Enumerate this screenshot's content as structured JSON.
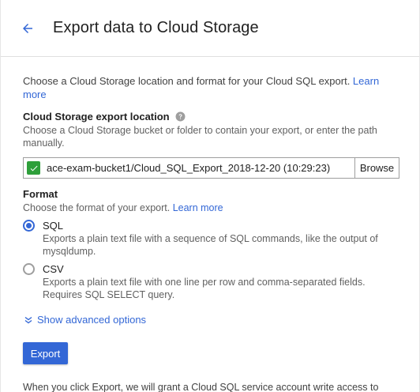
{
  "header": {
    "back_icon": "arrow-left-icon",
    "title": "Export data to Cloud Storage"
  },
  "intro": {
    "text": "Choose a Cloud Storage location and format for your Cloud SQL export. ",
    "link": "Learn more"
  },
  "location": {
    "label": "Cloud Storage export location",
    "help_icon": "help-icon",
    "hint": "Choose a Cloud Storage bucket or folder to contain your export, or enter the path manually.",
    "value": "ace-exam-bucket1/Cloud_SQL_Export_2018-12-20 (10:29:23)",
    "valid_icon": "check-icon",
    "browse_label": "Browse"
  },
  "format": {
    "label": "Format",
    "hint": "Choose the format of your export. ",
    "hint_link": "Learn more",
    "selected": "SQL",
    "options": [
      {
        "label": "SQL",
        "description": "Exports a plain text file with a sequence of SQL commands, like the output of mysqldump."
      },
      {
        "label": "CSV",
        "description": "Exports a plain text file with one line per row and comma-separated fields. Requires SQL SELECT query."
      }
    ]
  },
  "advanced": {
    "label": "Show advanced options",
    "icon": "double-chevron-down-icon"
  },
  "actions": {
    "export_label": "Export"
  },
  "footer": {
    "note": "When you click Export, we will grant a Cloud SQL service account write access to your bucket. Your bucket permissions will reflect this access."
  },
  "colors": {
    "accent": "#3367d6",
    "valid": "#2e9f3a"
  }
}
